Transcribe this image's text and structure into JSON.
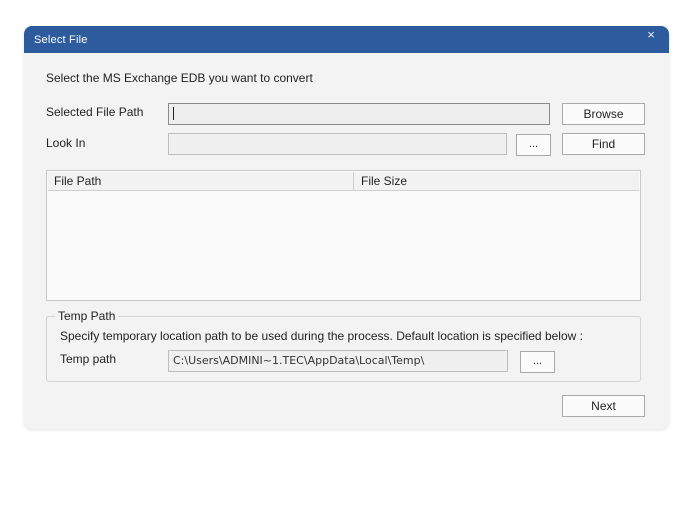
{
  "window": {
    "title": "Select File",
    "close_symbol": "×"
  },
  "instructions": "Select the MS Exchange EDB you want to convert",
  "selected_file_path": {
    "label": "Selected File Path",
    "value": ""
  },
  "browse_button": "Browse",
  "look_in": {
    "label": "Look In",
    "value": ""
  },
  "look_in_button": "...",
  "find_button": "Find",
  "grid": {
    "columns": [
      "File Path",
      "File Size"
    ]
  },
  "temp_path": {
    "group_label": "Temp Path",
    "description": "Specify temporary location path to be used during the process. Default location is specified below :",
    "label": "Temp path",
    "value": "C:\\Users\\ADMINI~1.TEC\\AppData\\Local\\Temp\\",
    "browse_button": "..."
  },
  "next_button": "Next",
  "colors": {
    "titlebar": "#2d5b9e",
    "window_background": "#f3f3f3"
  }
}
